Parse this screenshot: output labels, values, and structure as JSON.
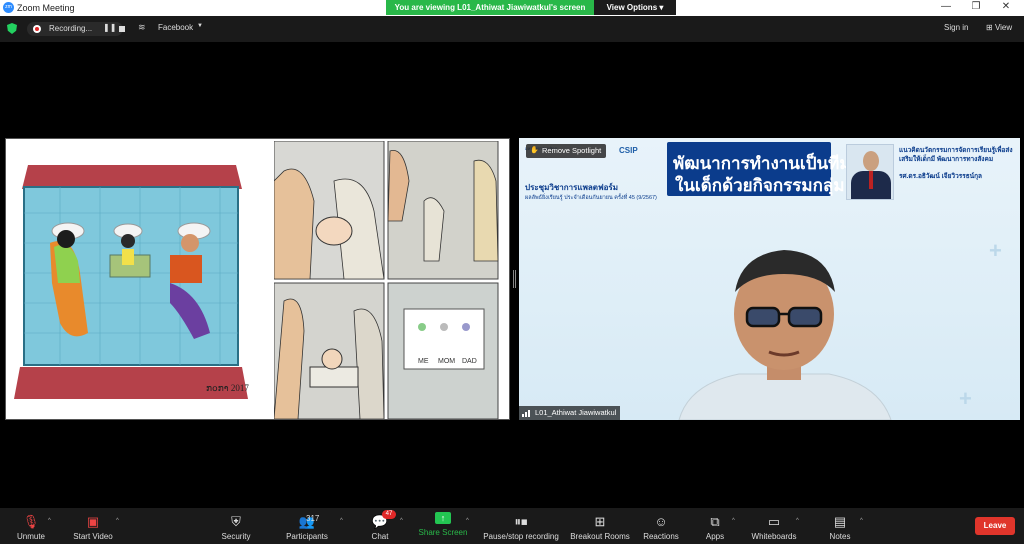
{
  "window": {
    "title": "Zoom Meeting",
    "viewing_banner": "You are viewing L01_Athiwat Jiawiwatkul's screen",
    "view_options": "View Options",
    "controls": [
      "—",
      "❐",
      "✕"
    ]
  },
  "meeting_bar": {
    "recording_label": "Recording...",
    "live_target": "Facebook",
    "sign_in": "Sign in",
    "view": "View"
  },
  "share": {
    "comic_labels": [
      "ME",
      "MOM",
      "DAD"
    ],
    "signature": "ກ໐ກາ 2017"
  },
  "video": {
    "remove_spotlight": "Remove Spotlight",
    "csip": "CSIP",
    "slide_title_line1": "พัฒนาการทำงานเป็นทีม",
    "slide_title_line2": "ในเด็กด้วยกิจกรรมกลุ่ม",
    "meeting_title": "ประชุมวิชาการแพลตฟอร์ม",
    "meeting_subtitle": "ผลลัพธ์ยิ่งเรียนรู้ ประจำเดือนกันยายน ครั้งที่ 45 (9/2567)",
    "right_heading": "แนวคิดนวัตกรรมการจัดการเรียนรู้เพื่อส่งเสริมให้เด็กมี พัฒนาการทางสังคม",
    "speaker_name": "รศ.ดร.อธิวัฒน์ เจียวิวรรธน์กุล",
    "name_tag": "L01_Athiwat Jiawiwatkul"
  },
  "toolbar": {
    "unmute": "Unmute",
    "start_video": "Start Video",
    "security": "Security",
    "participants": "Participants",
    "participant_count": "317",
    "chat": "Chat",
    "chat_badge": "47",
    "share_screen": "Share Screen",
    "pause_recording": "Pause/stop recording",
    "breakout_rooms": "Breakout Rooms",
    "reactions": "Reactions",
    "apps": "Apps",
    "whiteboards": "Whiteboards",
    "notes": "Notes",
    "leave": "Leave"
  },
  "colors": {
    "banner_green": "#29b849",
    "share_green": "#23c552",
    "leave_red": "#e0352b",
    "slide_blue": "#0b3c8c"
  }
}
